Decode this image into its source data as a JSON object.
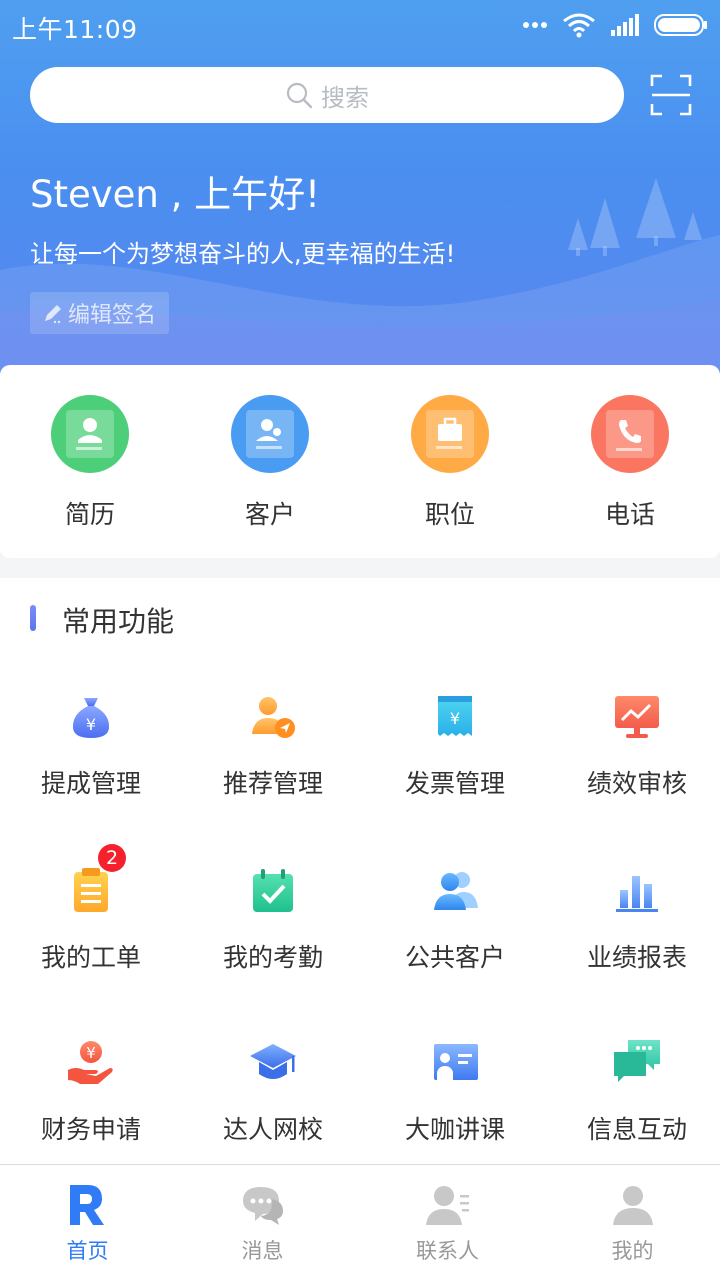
{
  "status_bar": {
    "time": "上午11:09"
  },
  "search": {
    "placeholder": "搜索"
  },
  "header": {
    "greeting": "Steven , 上午好!",
    "motto": "让每一个为梦想奋斗的人,更幸福的生活!",
    "edit_signature": "编辑签名"
  },
  "quick_actions": [
    {
      "label": "简历",
      "icon": "resume-icon",
      "color": "#4ccf78"
    },
    {
      "label": "客户",
      "icon": "customer-icon",
      "color": "#4a9cf2"
    },
    {
      "label": "职位",
      "icon": "position-icon",
      "color": "#ffaa45"
    },
    {
      "label": "电话",
      "icon": "phone-icon",
      "color": "#fa7660"
    }
  ],
  "common_functions": {
    "title": "常用功能",
    "items": [
      {
        "label": "提成管理",
        "icon": "money-bag-icon"
      },
      {
        "label": "推荐管理",
        "icon": "recommend-user-icon"
      },
      {
        "label": "发票管理",
        "icon": "invoice-icon"
      },
      {
        "label": "绩效审核",
        "icon": "performance-chart-icon"
      },
      {
        "label": "我的工单",
        "icon": "clipboard-icon",
        "badge": "2"
      },
      {
        "label": "我的考勤",
        "icon": "calendar-check-icon"
      },
      {
        "label": "公共客户",
        "icon": "public-users-icon"
      },
      {
        "label": "业绩报表",
        "icon": "bar-chart-icon"
      },
      {
        "label": "财务申请",
        "icon": "hand-money-icon"
      },
      {
        "label": "达人网校",
        "icon": "graduation-cap-icon"
      },
      {
        "label": "大咖讲课",
        "icon": "lecture-board-icon"
      },
      {
        "label": "信息互动",
        "icon": "chat-bubbles-icon"
      }
    ]
  },
  "tabbar": [
    {
      "label": "首页",
      "icon": "home-logo-icon",
      "active": true
    },
    {
      "label": "消息",
      "icon": "message-icon",
      "active": false
    },
    {
      "label": "联系人",
      "icon": "contacts-icon",
      "active": false
    },
    {
      "label": "我的",
      "icon": "profile-icon",
      "active": false
    }
  ],
  "colors": {
    "primary": "#2f7cf6",
    "badge": "#f5222d",
    "hero_top": "#4f9ff0",
    "hero_bottom": "#5b86ef"
  }
}
